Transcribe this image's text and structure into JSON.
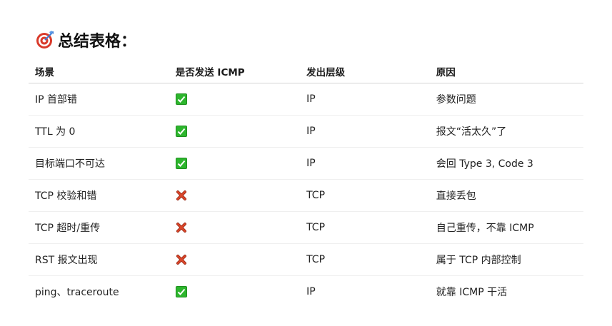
{
  "heading": {
    "icon": "target-icon",
    "title": "总结表格："
  },
  "table": {
    "headers": [
      "场景",
      "是否发送 ICMP",
      "发出层级",
      "原因"
    ],
    "rows": [
      {
        "scenario": "IP 首部错",
        "sends_icmp": "check-icon",
        "layer": "IP",
        "reason": "参数问题"
      },
      {
        "scenario": "TTL 为 0",
        "sends_icmp": "check-icon",
        "layer": "IP",
        "reason": "报文“活太久”了"
      },
      {
        "scenario": "目标端口不可达",
        "sends_icmp": "check-icon",
        "layer": "IP",
        "reason": "会回 Type 3, Code 3"
      },
      {
        "scenario": "TCP 校验和错",
        "sends_icmp": "cross-icon",
        "layer": "TCP",
        "reason": "直接丢包"
      },
      {
        "scenario": "TCP 超时/重传",
        "sends_icmp": "cross-icon",
        "layer": "TCP",
        "reason": "自己重传，不靠 ICMP"
      },
      {
        "scenario": "RST 报文出现",
        "sends_icmp": "cross-icon",
        "layer": "TCP",
        "reason": "属于 TCP 内部控制"
      },
      {
        "scenario": "ping、traceroute",
        "sends_icmp": "check-icon",
        "layer": "IP",
        "reason": "就靠 ICMP 干活"
      }
    ]
  },
  "colors": {
    "check": "#2db52d",
    "cross": "#c8381f",
    "target_red": "#d93a2b",
    "arrow_blue": "#3a7bd5"
  }
}
